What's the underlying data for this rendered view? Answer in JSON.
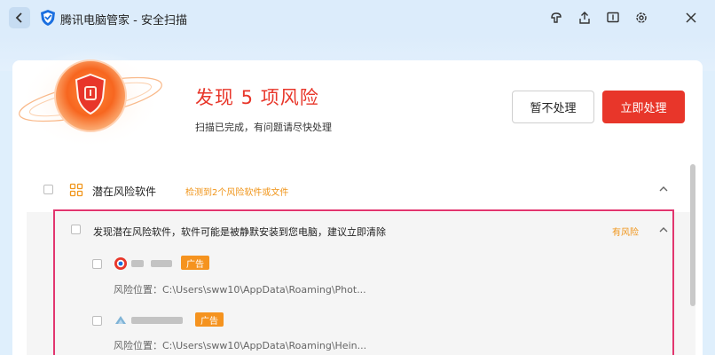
{
  "titlebar": {
    "title": "腾讯电脑管家 - 安全扫描",
    "icons": [
      "back-icon",
      "skin-icon",
      "share-icon",
      "feedback-icon",
      "settings-icon",
      "close-icon"
    ]
  },
  "summary": {
    "title": "发现 5 项风险",
    "subtitle": "扫描已完成，有问题请尽快处理",
    "ignore_label": "暂不处理",
    "fix_label": "立即处理"
  },
  "section": {
    "title": "潜在风险软件",
    "detected": "检测到2个风险软件或文件"
  },
  "group": {
    "title": "发现潜在风险软件，软件可能是被静默安装到您电脑，建议立即清除",
    "status": "有风险",
    "items": [
      {
        "badge": "广告",
        "path": "风险位置：C:\\Users\\sww10\\AppData\\Roaming\\Phot..."
      },
      {
        "badge": "广告",
        "path": "风险位置：C:\\Users\\sww10\\AppData\\Roaming\\Hein..."
      }
    ]
  },
  "colors": {
    "danger": "#e8362a",
    "warning": "#f0951a",
    "badge": "#f5931f",
    "highlight": "#e2366f"
  }
}
